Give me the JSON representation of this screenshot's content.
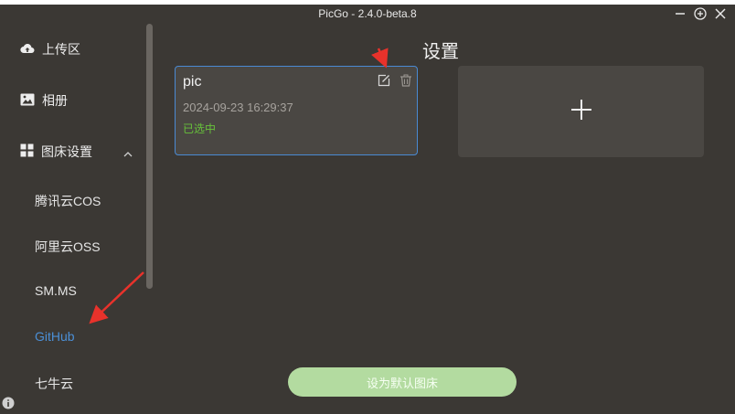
{
  "window": {
    "title": "PicGo - 2.4.0-beta.8"
  },
  "sidebar": {
    "upload_label": "上传区",
    "album_label": "相册",
    "picbed_settings_label": "图床设置",
    "picbeds": [
      "腾讯云COS",
      "阿里云OSS",
      "SM.MS",
      "GitHub",
      "七牛云"
    ],
    "active_picbed": "GitHub"
  },
  "main": {
    "title": "设置",
    "config_card": {
      "name": "pic",
      "date": "2024-09-23 16:29:37",
      "status": "已选中"
    },
    "default_button_label": "设为默认图床"
  },
  "icons": {
    "upload": "cloud-upload-icon",
    "album": "image-icon",
    "settings": "grid-icon",
    "collapse": "chevron-up-icon",
    "edit": "edit-icon",
    "delete": "trash-icon",
    "add": "plus-icon",
    "info": "info-icon"
  },
  "colors": {
    "background": "#3b3834",
    "card": "#4a4743",
    "accent_blue": "#4a8ad3",
    "selected_green": "#67c23a",
    "button_green": "#b3dba0",
    "annotation_red": "#e8322b"
  }
}
